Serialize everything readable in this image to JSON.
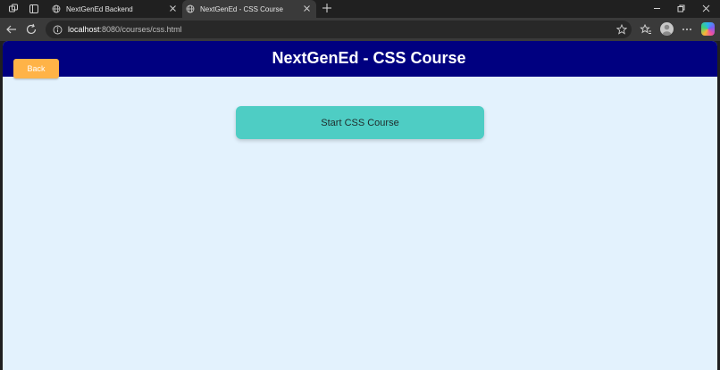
{
  "browser": {
    "tabs": [
      {
        "title": "NextGenEd Backend",
        "active": false
      },
      {
        "title": "NextGenEd - CSS Course",
        "active": true
      }
    ],
    "address": {
      "host": "localhost",
      "path": ":8080/courses/css.html"
    }
  },
  "page": {
    "header_title": "NextGenEd - CSS Course",
    "back_label": "Back",
    "start_label": "Start CSS Course"
  },
  "colors": {
    "header_bg": "#000080",
    "back_bg": "#ffb347",
    "start_bg": "#4ecdc4",
    "page_bg": "#e3f2fd"
  }
}
